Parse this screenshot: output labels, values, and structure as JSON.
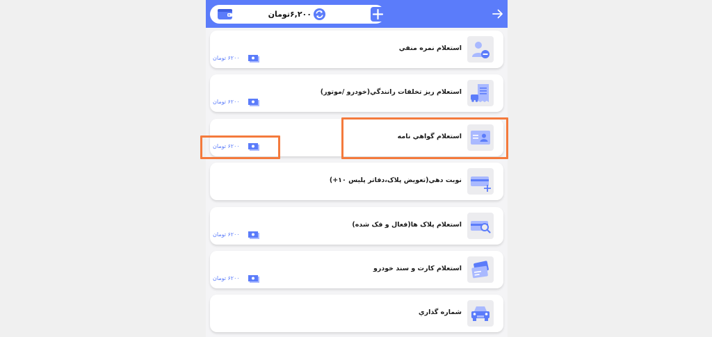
{
  "header": {
    "balance": "۶,۲۰۰تومان",
    "icons": [
      "wallet-icon",
      "refresh-icon",
      "plus-icon",
      "arrow-right-icon"
    ]
  },
  "services": [
    {
      "title": "استعلام نمره منفي",
      "price": "۶۲۰۰ تومان",
      "icon": "user-minus-icon"
    },
    {
      "title": "استعلام ريز تخلفات رانندگي(خودرو /موتور)",
      "price": "۶۲۰۰ تومان",
      "icon": "receipt-car-icon"
    },
    {
      "title": "استعلام گواهي نامه",
      "price": "۶۲۰۰ تومان",
      "icon": "id-card-icon"
    },
    {
      "title": "نوبت دهي(تعويض پلاک،دفاتر پليس ۱۰+)",
      "price": "",
      "icon": "plate-plus-icon"
    },
    {
      "title": "استعلام پلاک ها(فعال و فک شده)",
      "price": "۶۲۰۰ تومان",
      "icon": "plate-search-icon"
    },
    {
      "title": "استعلام کارت و سند خودرو",
      "price": "۶۲۰۰ تومان",
      "icon": "cards-icon"
    },
    {
      "title": "شماره گذاري",
      "price": "",
      "icon": "car-icon"
    }
  ],
  "colors": {
    "accent": "#5b7cfa",
    "highlight": "#f47a3c",
    "icon_fill": "#a9b9ff"
  }
}
